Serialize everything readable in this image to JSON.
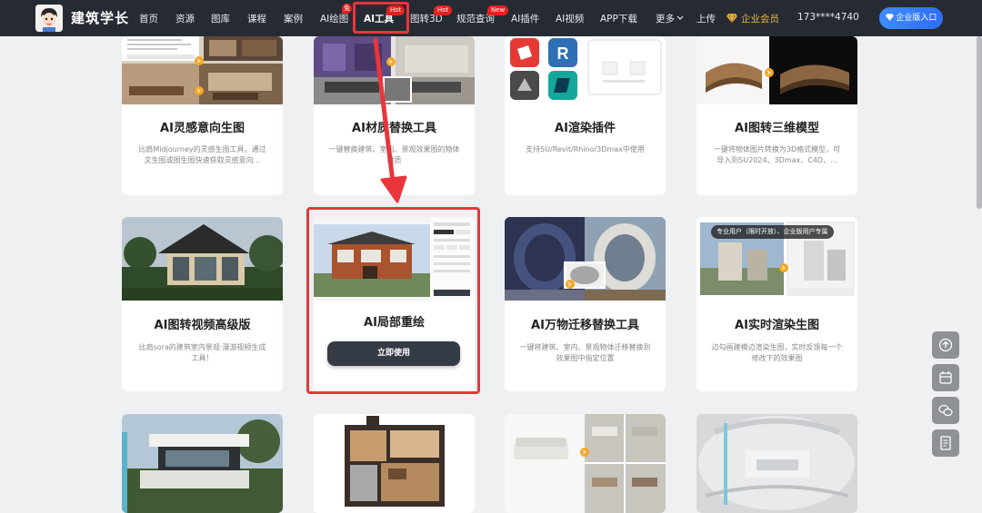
{
  "nav": {
    "logo_text": "建筑学长",
    "items": [
      {
        "label": "首页"
      },
      {
        "label": "资源"
      },
      {
        "label": "图库"
      },
      {
        "label": "课程"
      },
      {
        "label": "案例"
      },
      {
        "label": "AI绘图",
        "badge": "免"
      },
      {
        "label": "AI工具",
        "badge": "Hot",
        "active": true
      },
      {
        "label": "图转3D",
        "badge": "Hot"
      },
      {
        "label": "规范查询",
        "badge": "New"
      },
      {
        "label": "AI插件"
      },
      {
        "label": "AI视频"
      },
      {
        "label": "APP下载"
      },
      {
        "label": "更多"
      },
      {
        "label": "上传"
      }
    ],
    "vip_label": "企业会员",
    "phone": "173****4740",
    "enterprise_button": "企业版入口",
    "colors": {
      "bar": "#262b33",
      "badge": "#e4211f",
      "highlight": "#e8363a",
      "vip": "#e7b44a",
      "enterprise": "#2f6ef2"
    }
  },
  "cards": [
    {
      "title": "AI灵感意向生图",
      "desc": "比肩Midjourney的灵感生图工具，通过文生图或图生图快速获取灵感意向..."
    },
    {
      "title": "AI材质替换工具",
      "desc": "一键替换建筑、室内、景观效果图的物体材质"
    },
    {
      "title": "AI渲染插件",
      "desc": "支持SU/Revit/Rhino/3Dmax中使用"
    },
    {
      "title": "AI图转三维模型",
      "desc": "一键将物体图片转换为3D格式模型，可导入到SU2024、3Dmax、C4D、..."
    },
    {
      "title": "AI图转视频高级版",
      "desc": "比肩sora的建筑室内景观·漫游视频生成工具！"
    },
    {
      "title": "AI局部重绘",
      "button": "立即使用",
      "highlighted": true
    },
    {
      "title": "AI万物迁移替换工具",
      "desc": "一键将建筑、室内、景观物体迁移替换到效果图中指定位置"
    },
    {
      "title": "AI实时渲染生图",
      "desc": "边勾画建模边渲染生图，实时反馈每一个修改下的效果图",
      "tag": "专业用户（限时开放）、企业版用户专属"
    }
  ],
  "floating_tools": [
    "arrow-up-icon",
    "calendar-icon",
    "wechat-icon",
    "feedback-icon"
  ]
}
